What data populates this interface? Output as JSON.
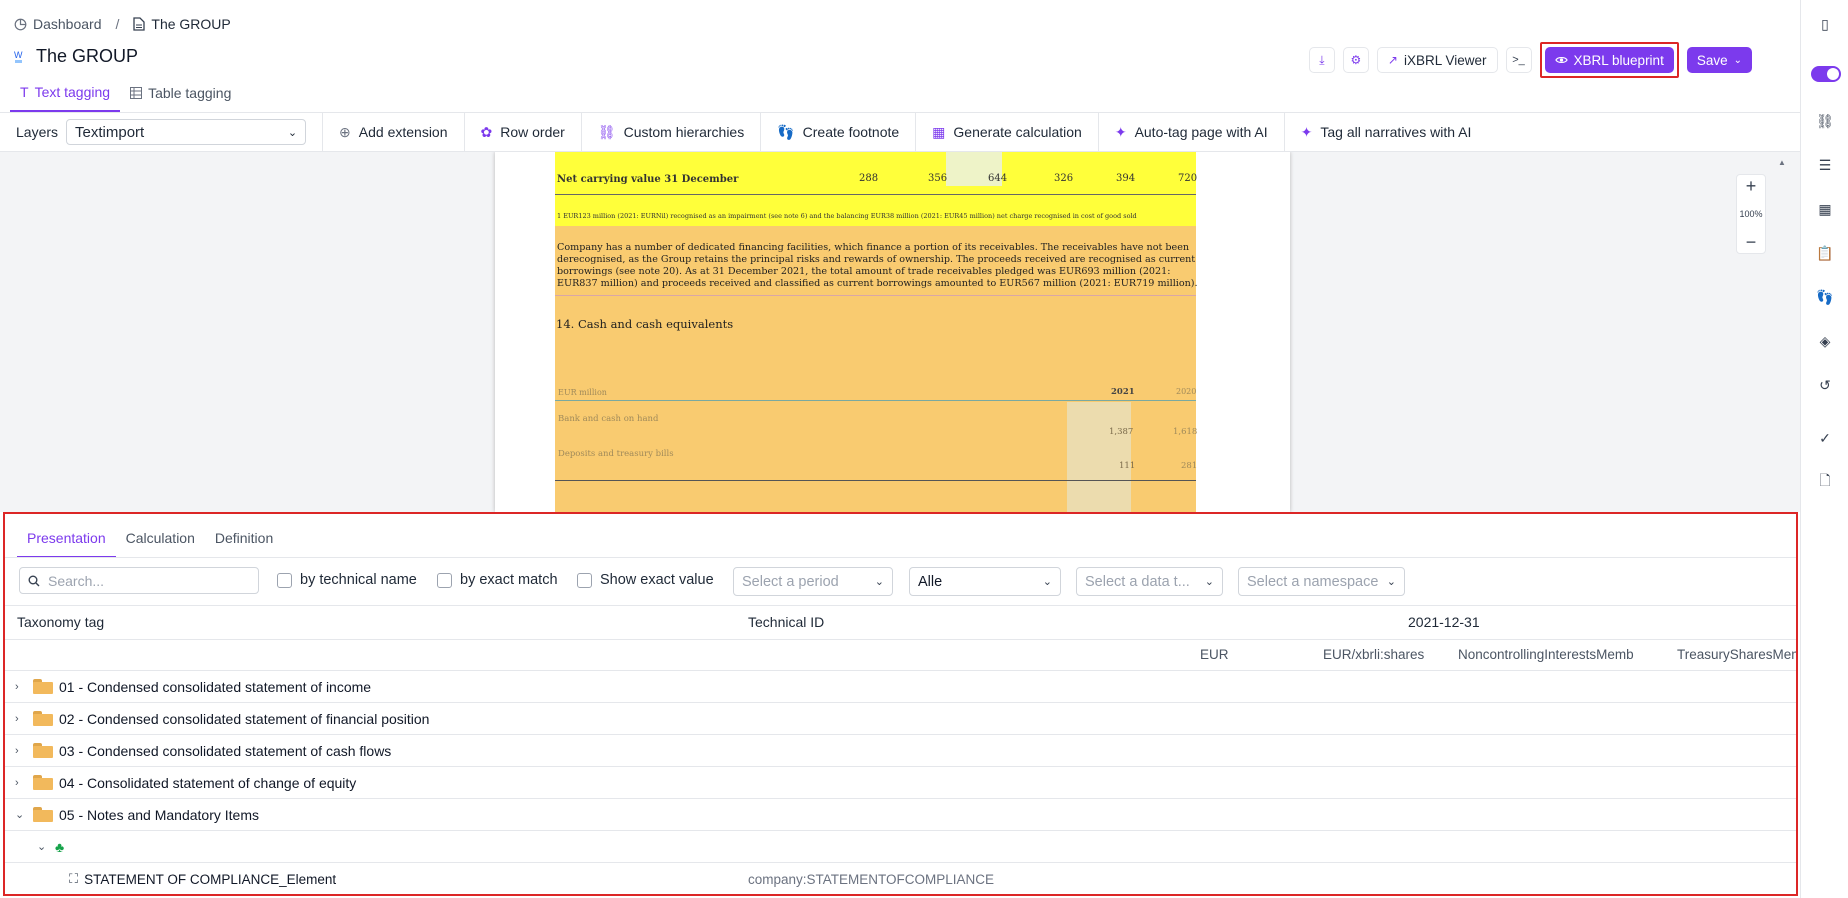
{
  "breadcrumb": {
    "home": "Dashboard",
    "separator": "/",
    "current": "The GROUP"
  },
  "page_title": "The GROUP",
  "top_tabs": [
    {
      "label": "Text tagging"
    },
    {
      "label": "Table tagging"
    }
  ],
  "top_actions": {
    "ixbrl_viewer": "iXBRL Viewer",
    "xbrl_blueprint": "XBRL blueprint",
    "save": "Save",
    "terminal": ">_"
  },
  "toolbar": {
    "layers_label": "Layers",
    "layers_value": "Textimport",
    "items": [
      "Add extension",
      "Row order",
      "Custom hierarchies",
      "Create footnote",
      "Generate calculation",
      "Auto-tag page with AI",
      "Tag all narratives with AI"
    ]
  },
  "document": {
    "row1_label": "Net carrying value 31 December",
    "row1_values": [
      "288",
      "356",
      "644",
      "326",
      "394",
      "720"
    ],
    "footnote": "1   EUR123 million (2021: EURNil) recognised as an impairment (see note 6) and the balancing EUR38 million (2021: EUR45 million) net charge recognised in cost of good sold",
    "para_lines": [
      "Company has a number of dedicated financing facilities, which finance a portion of its receivables. The receivables have not been",
      "derecognised, as the Group retains the principal risks and rewards of ownership. The proceeds received are recognised as current",
      "borrowings (see note 20). As at 31 December 2021, the total amount of trade receivables pledged was EUR693 million (2021:",
      "EUR837 million) and proceeds received and classified as current borrowings amounted to EUR567 million (2021: EUR719 million)."
    ],
    "heading": "14. Cash and cash equivalents",
    "unit_label": "EUR million",
    "year_a": "2021",
    "year_b": "2020",
    "rows": [
      {
        "label": "Bank and cash on hand",
        "a": "1,387",
        "b": "1,618"
      },
      {
        "label": "Deposits and treasury bills",
        "a": "111",
        "b": "281"
      }
    ]
  },
  "zoom": {
    "plus": "+",
    "level": "100%",
    "minus": "−"
  },
  "panel": {
    "tabs": [
      "Presentation",
      "Calculation",
      "Definition"
    ],
    "search_placeholder": "Search...",
    "checkboxes": [
      "by technical name",
      "by exact match",
      "Show exact value"
    ],
    "filters": {
      "period": "Select a period",
      "lang": "Alle",
      "datatype": "Select a data t...",
      "namespace": "Select a namespace"
    },
    "columns": {
      "taxonomy": "Taxonomy tag",
      "technical_id": "Technical ID",
      "date": "2021-12-31"
    },
    "subcolumns": [
      "EUR",
      "EUR/xbrli:shares",
      "NoncontrollingInterestsMemb",
      "TreasurySharesMember"
    ],
    "rows": [
      {
        "label": "01 - Condensed consolidated statement of income"
      },
      {
        "label": "02 - Condensed consolidated statement of financial position"
      },
      {
        "label": "03 - Condensed consolidated statement of cash flows"
      },
      {
        "label": "04 - Consolidated statement of change of equity"
      },
      {
        "label": "05 - Notes and Mandatory Items"
      }
    ],
    "element": {
      "label": "STATEMENT OF COMPLIANCE_Element",
      "technical_id": "company:STATEMENTOFCOMPLIANCE"
    }
  },
  "colors": {
    "accent": "#7c3aed",
    "highlight_yellow": "#ffff3a",
    "highlight_orange": "#f9cb70",
    "red_outline": "#dc2626"
  }
}
